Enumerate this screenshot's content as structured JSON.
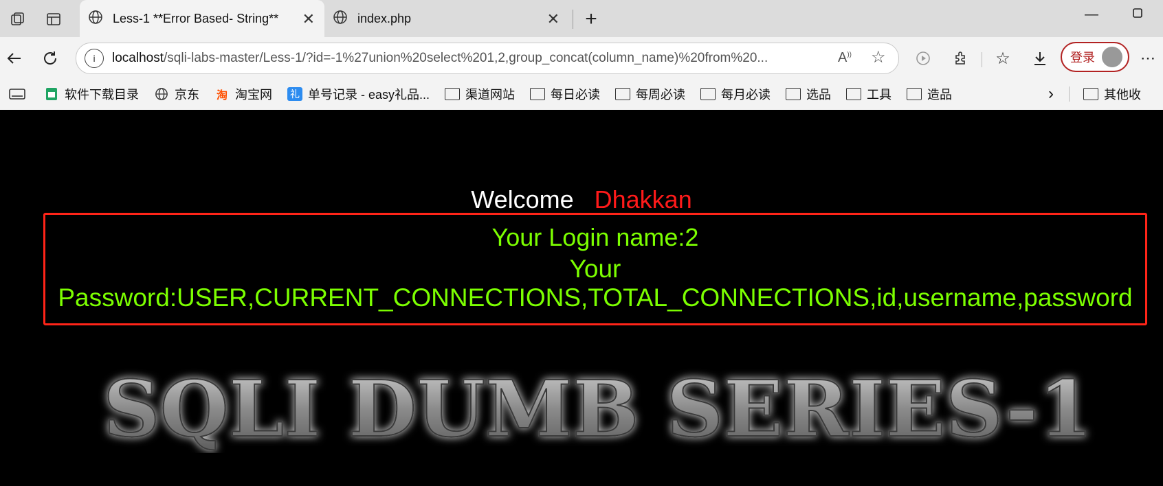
{
  "tabs": [
    {
      "title": "Less-1 **Error Based- String**",
      "active": true
    },
    {
      "title": "index.php",
      "active": false
    }
  ],
  "address": {
    "host": "localhost",
    "rest": "/sqli-labs-master/Less-1/?id=-1%27union%20select%201,2,group_concat(column_name)%20from%20..."
  },
  "profile": {
    "login_label": "登录"
  },
  "favorites": [
    {
      "label": "软件下载目录",
      "icon": "sheets-icon"
    },
    {
      "label": "京东",
      "icon": "globe-icon"
    },
    {
      "label": "淘宝网",
      "icon": "taobao-icon"
    },
    {
      "label": "单号记录 - easy礼品...",
      "icon": "gift-icon"
    },
    {
      "label": "渠道网站",
      "icon": "folder-icon"
    },
    {
      "label": "每日必读",
      "icon": "folder-icon"
    },
    {
      "label": "每周必读",
      "icon": "folder-icon"
    },
    {
      "label": "每月必读",
      "icon": "folder-icon"
    },
    {
      "label": "选品",
      "icon": "folder-icon"
    },
    {
      "label": "工具",
      "icon": "folder-icon"
    },
    {
      "label": "造品",
      "icon": "folder-icon"
    }
  ],
  "other_favorites": "其他收",
  "page": {
    "welcome": "Welcome",
    "user": "Dhakkan",
    "login_name": "Your Login name:2",
    "password": "Your Password:USER,CURRENT_CONNECTIONS,TOTAL_CONNECTIONS,id,username,password",
    "banner": "SQLI DUMB SERIES-1"
  },
  "colors": {
    "accent_red": "#ff2418",
    "result_green": "#7cff00"
  }
}
